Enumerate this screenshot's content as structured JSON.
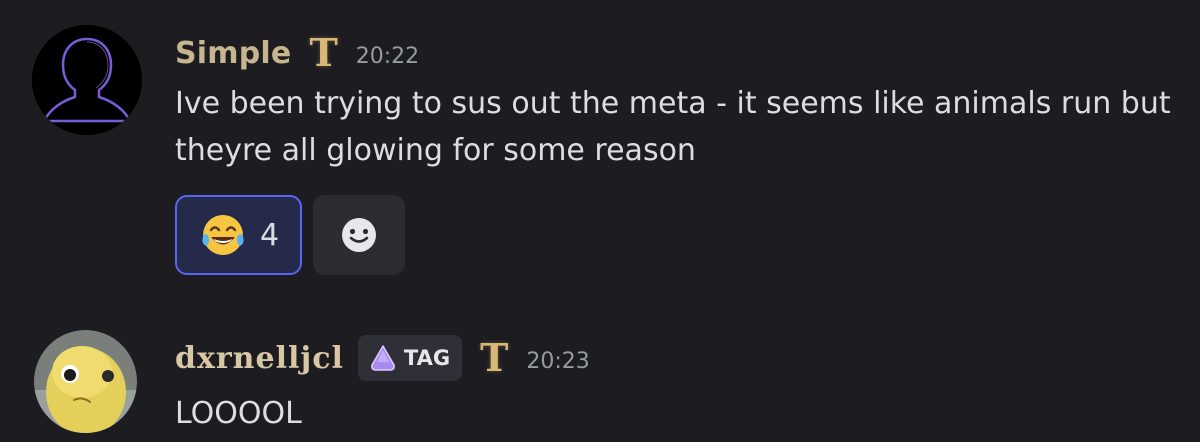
{
  "messages": [
    {
      "author": "Simple",
      "badge": "T",
      "time": "20:22",
      "content": "Ive been trying to sus out the meta - it seems like animals run but theyre all glowing for some reason",
      "reactions": [
        {
          "emoji": "joy-emoji",
          "count": "4",
          "active": true
        }
      ],
      "add_reaction_icon": "add-reaction-smile-icon"
    },
    {
      "author": "dxrnelljcl",
      "guild_tag": "TAG",
      "badge": "T",
      "time": "20:23",
      "content": "LOOOOL"
    }
  ],
  "colors": {
    "background": "#1c1c21",
    "username_simple": "#c7b58e",
    "username_gothic": "#d8c7a4",
    "badge_gold": "#d8b875",
    "timestamp": "#949ba4",
    "text": "#dbdee1",
    "reaction_active_border": "#5865f2"
  }
}
